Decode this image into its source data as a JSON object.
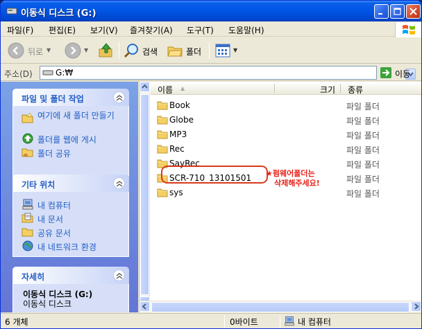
{
  "window": {
    "title": "이동식 디스크 (G:)"
  },
  "menu": {
    "items": [
      "파일(F)",
      "편집(E)",
      "보기(V)",
      "즐겨찾기(A)",
      "도구(T)",
      "도움말(H)"
    ]
  },
  "toolbar": {
    "back_label": "뒤로",
    "search_label": "검색",
    "folders_label": "폴더"
  },
  "address": {
    "label": "주소(D)",
    "value": "G:₩",
    "go_label": "이동"
  },
  "left": {
    "tasks": {
      "title": "파일 및 폴더 작업",
      "items": [
        {
          "label": "여기에 새 폴더 만들기",
          "icon": "new-folder-icon"
        },
        {
          "label": "폴더를 웹에 게시",
          "icon": "web-publish-icon"
        },
        {
          "label": "폴더 공유",
          "icon": "share-folder-icon"
        }
      ]
    },
    "places": {
      "title": "기타 위치",
      "items": [
        {
          "label": "내 컴퓨터",
          "icon": "my-computer-icon"
        },
        {
          "label": "내 문서",
          "icon": "my-documents-icon"
        },
        {
          "label": "공유 문서",
          "icon": "shared-documents-icon"
        },
        {
          "label": "내 네트워크 환경",
          "icon": "network-icon"
        }
      ]
    },
    "details": {
      "title": "자세히",
      "name": "이동식 디스크 (G:)",
      "subtitle": "이동식 디스크"
    }
  },
  "list": {
    "columns": {
      "name": "이름",
      "size": "크기",
      "type": "종류"
    },
    "rows": [
      {
        "name": "Book",
        "type": "파일 폴더"
      },
      {
        "name": "Globe",
        "type": "파일 폴더"
      },
      {
        "name": "MP3",
        "type": "파일 폴더"
      },
      {
        "name": "Rec",
        "type": "파일 폴더"
      },
      {
        "name": "SayRec",
        "type": "파일 폴더"
      },
      {
        "name": "SCR-710_13101501",
        "type": "파일 폴더"
      },
      {
        "name": "sys",
        "type": "파일 폴더"
      }
    ],
    "annotation": {
      "line1": "★펌웨어폴더는",
      "line2": "삭제해주세요!"
    }
  },
  "status": {
    "count": "6 개체",
    "size": "0바이트",
    "location": "내 컴퓨터"
  },
  "colors": {
    "title_blue": "#0055e5",
    "task_link": "#215dc6",
    "annotation_red": "#e8231a"
  }
}
